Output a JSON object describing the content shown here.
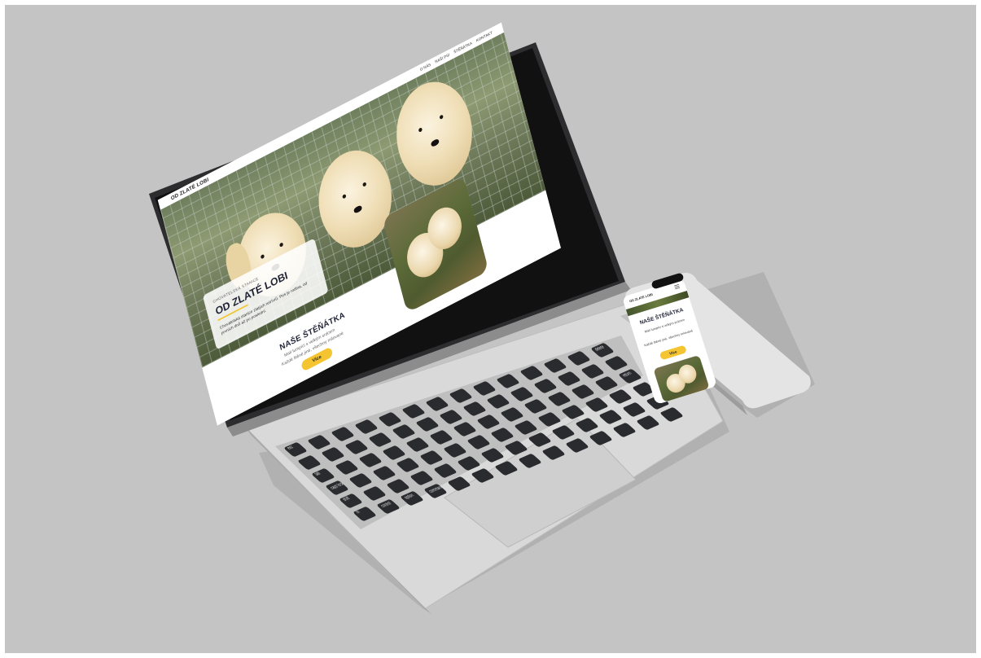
{
  "laptop_site": {
    "nav": {
      "logo": "OD ZLATÉ LOBI",
      "menu": [
        "O NÁS",
        "NAŠI PSI",
        "ŠTĚŇÁTKA",
        "KONTAKT"
      ]
    },
    "hero": {
      "eyebrow": "CHOVATELSKÁ STANICE",
      "title": "OD ZLATÉ LOBI",
      "description": "Chovatelská stanice zlatých retrívrů. Pes je rodina, od prvních dnů až po poslední."
    },
    "puppies": {
      "title": "NAŠE ŠTĚŇÁTKA",
      "line1": "Malí lumpíci s velkým srdcem",
      "line2": "Každé štěně jiné, všechny milované",
      "button": "Více"
    }
  },
  "phone_site": {
    "logo": "OD ZLATÉ LOBI",
    "title": "NAŠE ŠTĚŇÁTKA",
    "line1": "Malí lumpíci s velkým srdcem",
    "line2": "Každé štěně jiné, všechny milované",
    "button": "Více"
  },
  "keyboard": {
    "labels": [
      "esc",
      "tab",
      "caps lock",
      "shift",
      "fn",
      "control",
      "option",
      "command",
      "delete",
      "return"
    ]
  },
  "colors": {
    "accent": "#f4c531",
    "heading": "#1f2235",
    "backdrop": "#c4c4c4"
  }
}
